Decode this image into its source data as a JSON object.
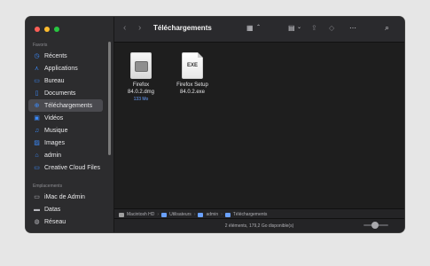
{
  "window": {
    "title": "Téléchargements"
  },
  "sidebar": {
    "favorites_label": "Favoris",
    "locations_label": "Emplacements",
    "favorites": [
      {
        "label": "Récents"
      },
      {
        "label": "Applications"
      },
      {
        "label": "Bureau"
      },
      {
        "label": "Documents"
      },
      {
        "label": "Téléchargements"
      },
      {
        "label": "Vidéos"
      },
      {
        "label": "Musique"
      },
      {
        "label": "Images"
      },
      {
        "label": "admin"
      },
      {
        "label": "Creative Cloud Files"
      }
    ],
    "locations": [
      {
        "label": "iMac de Admin"
      },
      {
        "label": "Datas"
      },
      {
        "label": "Réseau"
      }
    ]
  },
  "files": [
    {
      "name": "Firefox\n84.0.2.dmg",
      "size": "133 Mo",
      "type": "dmg-icon"
    },
    {
      "name": "Firefox Setup\n84.0.2.exe",
      "size": "",
      "type": "exe-icon",
      "badge": "EXE"
    }
  ],
  "pathbar": {
    "items": [
      "Macintosh HD",
      "Utilisateurs",
      "admin",
      "Téléchargements"
    ]
  },
  "status": {
    "text": "2 éléments, 179,2 Go disponible(s)"
  },
  "colors": {
    "accent": "#3b8cff",
    "close": "#ff5f57",
    "minimize": "#febc2e",
    "zoom": "#28c840"
  }
}
